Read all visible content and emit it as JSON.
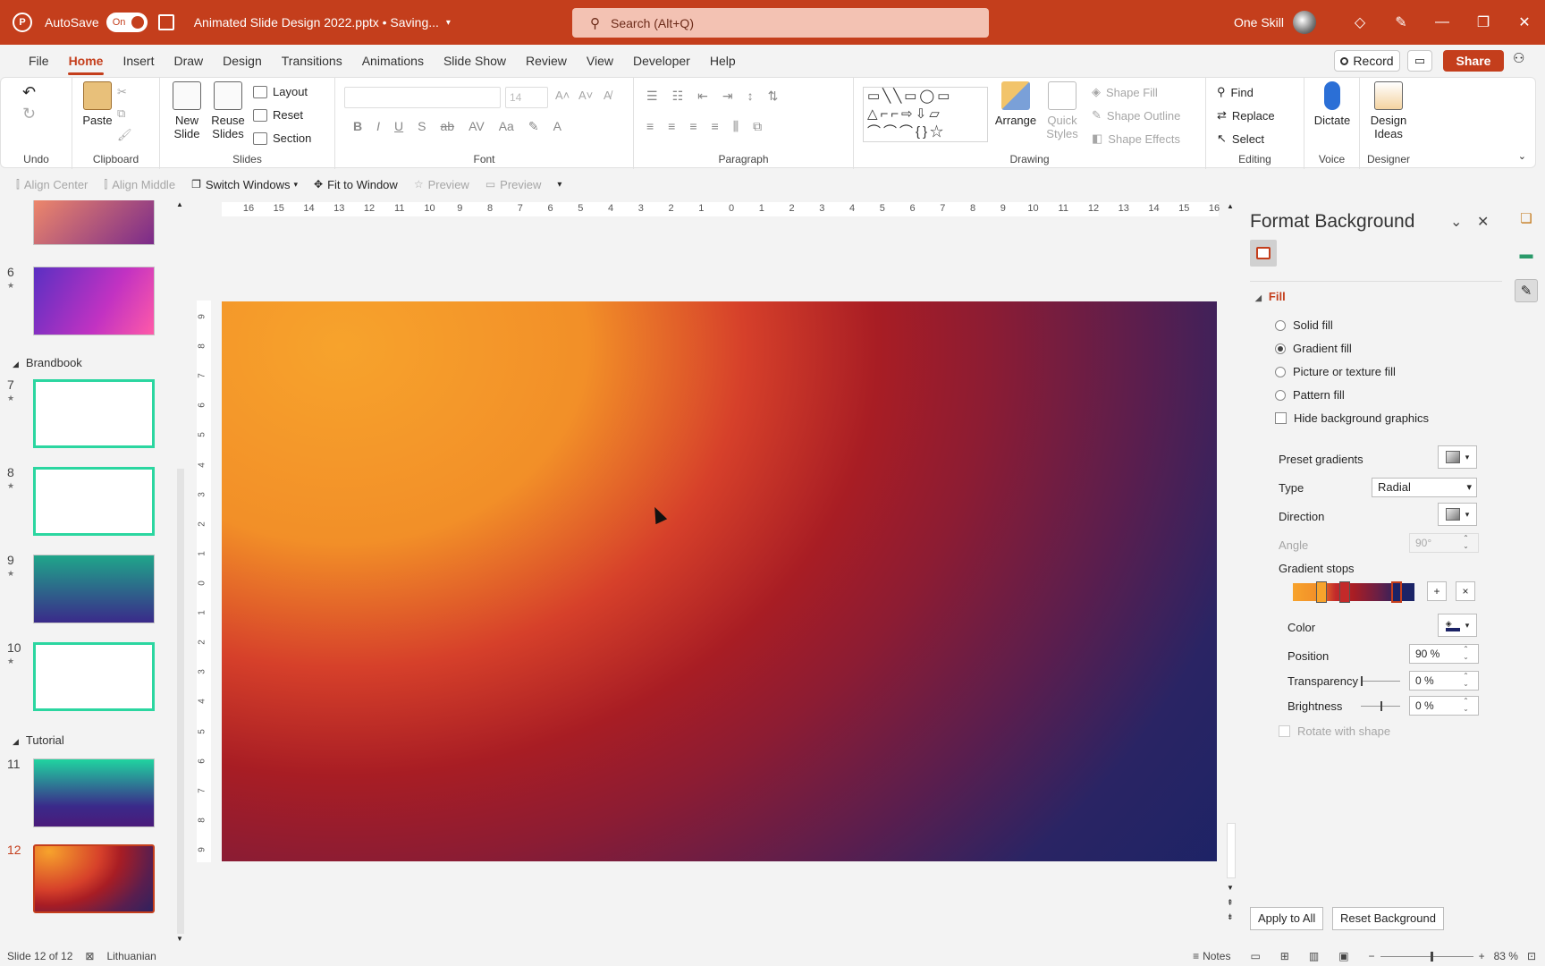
{
  "titlebar": {
    "autosave_label": "AutoSave",
    "autosave_state": "On",
    "document_title": "Animated Slide Design 2022.pptx • Saving...",
    "search_placeholder": "Search (Alt+Q)",
    "user_name": "One Skill"
  },
  "menu": {
    "tabs": [
      "File",
      "Home",
      "Insert",
      "Draw",
      "Design",
      "Transitions",
      "Animations",
      "Slide Show",
      "Review",
      "View",
      "Developer",
      "Help"
    ],
    "active": "Home",
    "record": "Record",
    "share": "Share"
  },
  "ribbon": {
    "undo_group": "Undo",
    "clipboard_group": "Clipboard",
    "paste": "Paste",
    "slides_group": "Slides",
    "new_slide": "New Slide",
    "reuse_slides": "Reuse Slides",
    "layout": "Layout",
    "reset": "Reset",
    "section": "Section",
    "font_group": "Font",
    "font_size": "14",
    "paragraph_group": "Paragraph",
    "drawing_group": "Drawing",
    "arrange": "Arrange",
    "quick_styles": "Quick Styles",
    "shape_fill": "Shape Fill",
    "shape_outline": "Shape Outline",
    "shape_effects": "Shape Effects",
    "editing_group": "Editing",
    "find": "Find",
    "replace": "Replace",
    "select": "Select",
    "voice_group": "Voice",
    "dictate": "Dictate",
    "designer_group": "Designer",
    "design_ideas": "Design Ideas"
  },
  "qat": {
    "align_center": "Align Center",
    "align_middle": "Align Middle",
    "switch_windows": "Switch Windows",
    "fit_to_window": "Fit to Window",
    "preview1": "Preview",
    "preview2": "Preview"
  },
  "thumbnails": {
    "sections": [
      "Brandbook",
      "Tutorial"
    ],
    "slide_numbers": [
      "6",
      "7",
      "8",
      "9",
      "10",
      "11",
      "12"
    ],
    "current": "12"
  },
  "ruler": {
    "h_ticks": [
      "16",
      "15",
      "14",
      "13",
      "12",
      "11",
      "10",
      "9",
      "8",
      "7",
      "6",
      "5",
      "4",
      "3",
      "2",
      "1",
      "0",
      "1",
      "2",
      "3",
      "4",
      "5",
      "6",
      "7",
      "8",
      "9",
      "10",
      "11",
      "12",
      "13",
      "14",
      "15",
      "16"
    ],
    "v_ticks": [
      "9",
      "8",
      "7",
      "6",
      "5",
      "4",
      "3",
      "2",
      "1",
      "0",
      "1",
      "2",
      "3",
      "4",
      "5",
      "6",
      "7",
      "8",
      "9"
    ]
  },
  "format_background": {
    "title": "Format Background",
    "section": "Fill",
    "options": [
      "Solid fill",
      "Gradient fill",
      "Picture or texture fill",
      "Pattern fill"
    ],
    "selected_option": "Gradient fill",
    "hide_graphics": "Hide background graphics",
    "preset_gradients": "Preset gradients",
    "type_label": "Type",
    "type_value": "Radial",
    "direction": "Direction",
    "angle_label": "Angle",
    "angle_value": "90°",
    "gradient_stops": "Gradient stops",
    "color": "Color",
    "position_label": "Position",
    "position_value": "90 %",
    "transparency_label": "Transparency",
    "transparency_value": "0 %",
    "brightness_label": "Brightness",
    "brightness_value": "0 %",
    "rotate_with_shape": "Rotate with shape",
    "apply_to_all": "Apply to All",
    "reset_background": "Reset Background"
  },
  "statusbar": {
    "slide_info": "Slide 12 of 12",
    "language": "Lithuanian",
    "notes": "Notes",
    "zoom": "83 %"
  },
  "colors": {
    "accent": "#c43e1c",
    "gradient_stops": [
      "#f7a32c",
      "#f28f28",
      "#c32a2a",
      "#a81d24",
      "#6a1f45",
      "#1b2366"
    ]
  }
}
